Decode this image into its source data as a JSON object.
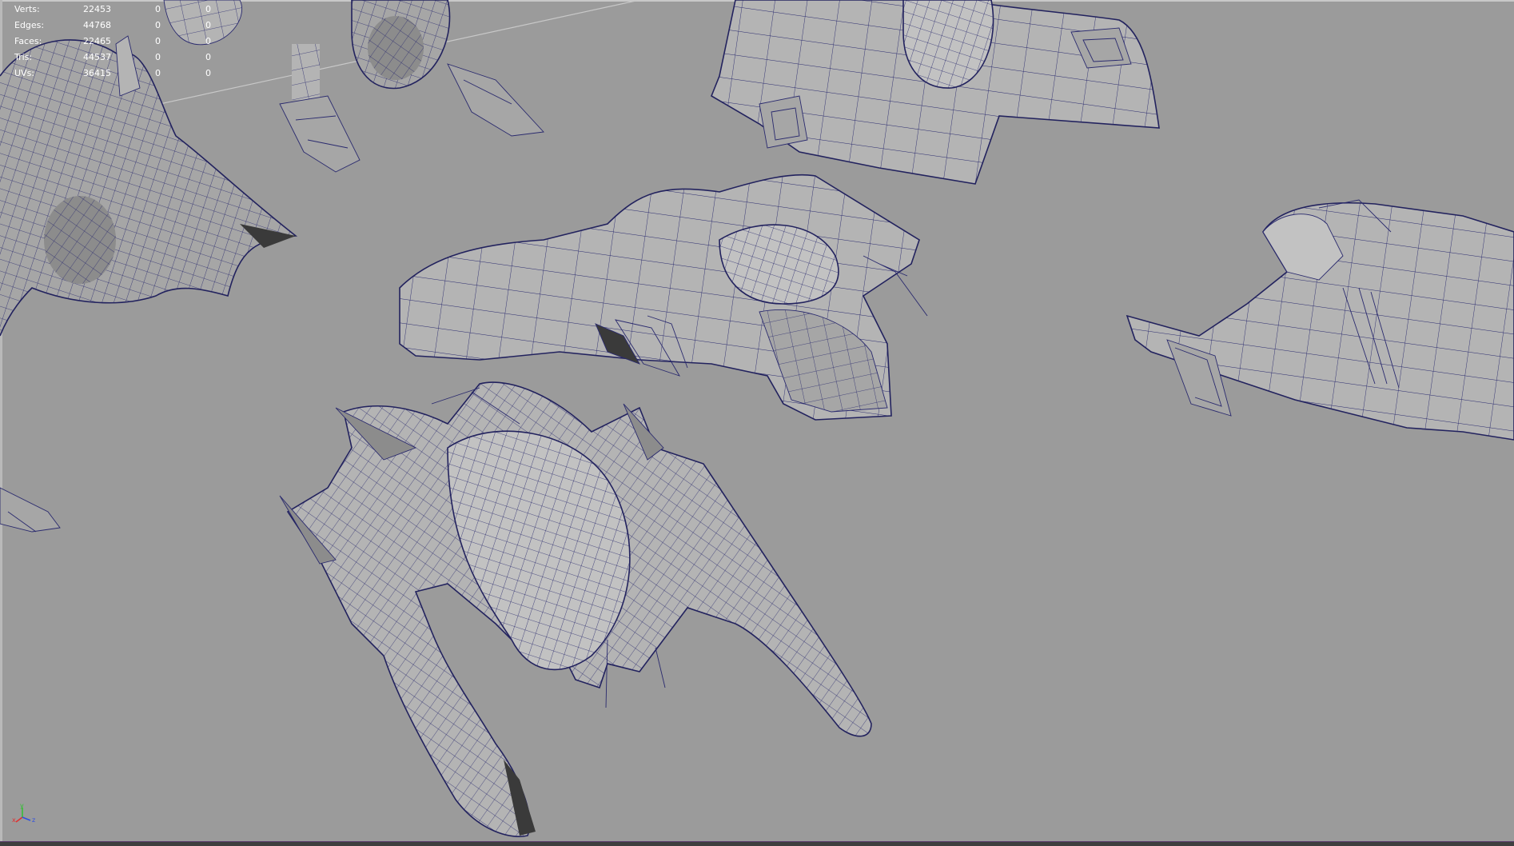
{
  "viewport": {
    "background": "#9b9b9b",
    "wire_color": "#2a2a6e"
  },
  "hud": {
    "rows": [
      {
        "label": "Verts:",
        "values": [
          "22453",
          "0",
          "0"
        ]
      },
      {
        "label": "Edges:",
        "values": [
          "44768",
          "0",
          "0"
        ]
      },
      {
        "label": "Faces:",
        "values": [
          "22465",
          "0",
          "0"
        ]
      },
      {
        "label": "Tris:",
        "values": [
          "44537",
          "0",
          "0"
        ]
      },
      {
        "label": "UVs:",
        "values": [
          "36415",
          "0",
          "0"
        ]
      }
    ]
  },
  "axis_gizmo": {
    "x_label": "x",
    "y_label": "y",
    "z_label": "z",
    "x_color": "#e03030",
    "y_color": "#30c030",
    "z_color": "#3050e0"
  }
}
